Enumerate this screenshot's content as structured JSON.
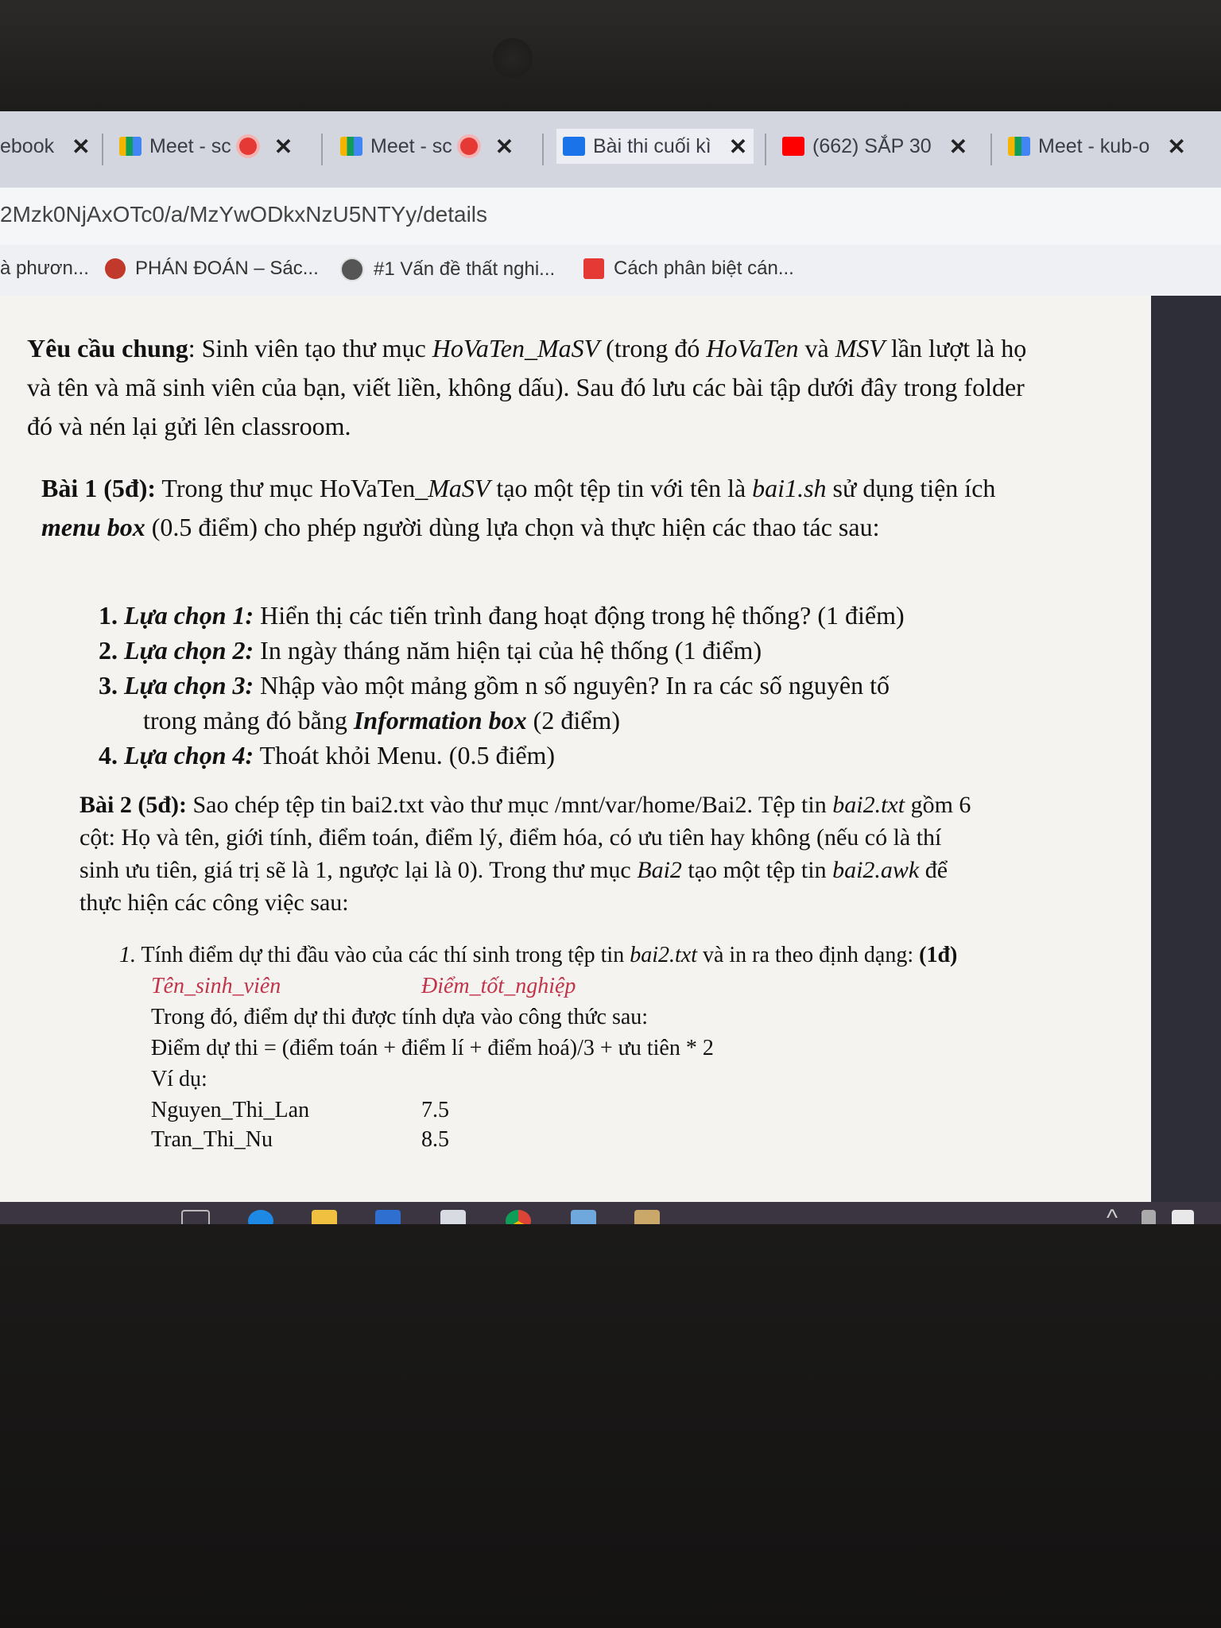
{
  "tabs": [
    {
      "label": "ebook",
      "icon": "book-icon"
    },
    {
      "label": "Meet - sc",
      "icon": "meet-icon",
      "recording": true
    },
    {
      "label": "Meet - sc",
      "icon": "meet-icon",
      "recording": true
    },
    {
      "label": "Bài thi cuối kì",
      "icon": "classroom-icon"
    },
    {
      "label": "(662) SẮP 30",
      "icon": "youtube-icon"
    },
    {
      "label": "Meet - kub-o",
      "icon": "meet-icon"
    }
  ],
  "close_glyph": "✕",
  "address": {
    "url": "2Mzk0NjAxOTc0/a/MzYwODkxNzU5NTYy/details"
  },
  "bookmarks": [
    {
      "label": "à phươn...",
      "icon": ""
    },
    {
      "label": "PHÁN ĐOÁN – Sác...",
      "icon": "bookmark-red-icon"
    },
    {
      "label": "#1 Vấn đề thất nghi...",
      "icon": "bookmark-globe-icon"
    },
    {
      "label": "Cách phân biệt cán...",
      "icon": "bookmark-arrow-icon"
    }
  ],
  "document": {
    "general": {
      "heading": "Yêu cầu chung",
      "text_1": ": Sinh viên tạo thư mục ",
      "folder": "HoVaTen_MaSV",
      "text_2": " (trong đó ",
      "hovaten": "HoVaTen",
      "text_3": " và ",
      "msv": "MSV",
      "text_4": " lần lượt là họ và tên và mã sinh viên của bạn, viết liền, không dấu). Sau đó lưu các bài tập dưới đây trong folder đó và nén lại gửi lên classroom."
    },
    "bai1": {
      "title": "Bài 1 (5đ):",
      "text_1": " Trong thư mục HoVaTen_",
      "masv": "MaSV",
      "text_2": " tạo một tệp tin với tên là ",
      "file": "bai1.sh",
      "text_3": " sử dụng tiện ích ",
      "menu": "menu box",
      "text_4": " (0.5 điểm) cho phép người dùng lựa chọn và thực hiện các thao tác sau:",
      "options": [
        {
          "num": "1.",
          "label": "Lựa chọn 1:",
          "text": " Hiển thị các tiến trình đang hoạt động trong hệ thống? (1 điểm)"
        },
        {
          "num": "2.",
          "label": "Lựa chọn 2:",
          "text": " In ngày tháng năm hiện tại của hệ thống (1 điểm)"
        },
        {
          "num": "3.",
          "label": "Lựa chọn 3:",
          "text": " Nhập vào một mảng gồm n số nguyên? In ra các số nguyên tố",
          "text_cont": "trong mảng đó bằng ",
          "info_box": "Information box",
          "text_end": " (2 điểm)"
        },
        {
          "num": "4.",
          "label": "Lựa chọn 4:",
          "text": " Thoát khỏi Menu. (0.5 điểm)"
        }
      ]
    },
    "bai2": {
      "title": "Bài 2 (5đ):",
      "text_1": " Sao chép tệp tin bai2.txt vào thư mục /mnt/var/home/Bai2. Tệp tin ",
      "file_txt": "bai2.txt",
      "text_2": " gồm 6 cột: Họ và tên, giới tính, điểm toán, điểm lý, điểm hóa, có ưu tiên hay không (nếu có là thí sinh ưu tiên, giá trị sẽ là 1, ngược lại là 0). Trong thư mục ",
      "folder": "Bai2",
      "text_3": " tạo một tệp tin ",
      "file_awk": "bai2.awk",
      "text_4": " để thực hiện các công việc sau:",
      "task1": {
        "num": "1.",
        "text": " Tính điểm dự thi đầu vào của các thí sinh trong tệp tin ",
        "file": "bai2.txt",
        "text_2": " và in ra theo định dạng: ",
        "points": "(1đ)",
        "col1": "Tên_sinh_viên",
        "col2": "Điểm_tốt_nghiệp",
        "note": "Trong đó, điểm dự thi được tính dựa vào công thức sau:",
        "formula": "Điểm dự thi = (điểm toán + điểm lí + điểm hoá)/3 + ưu tiên * 2",
        "example_label": "Ví dụ:",
        "examples": [
          {
            "name": "Nguyen_Thi_Lan",
            "score": "7.5"
          },
          {
            "name": "Tran_Thi_Nu",
            "score": "8.5"
          }
        ]
      }
    }
  },
  "taskbar": {
    "icons": [
      "task-view-icon",
      "edge-icon",
      "file-explorer-icon",
      "store-icon",
      "mail-icon",
      "chrome-icon",
      "virtualbox-icon",
      "paint-icon"
    ],
    "tray_glyph": "^"
  },
  "colors": {
    "tabbar": "#d3d6df",
    "page": "#f4f3f0",
    "accent_red": "#c2344a",
    "taskbar": "#3a3540"
  }
}
